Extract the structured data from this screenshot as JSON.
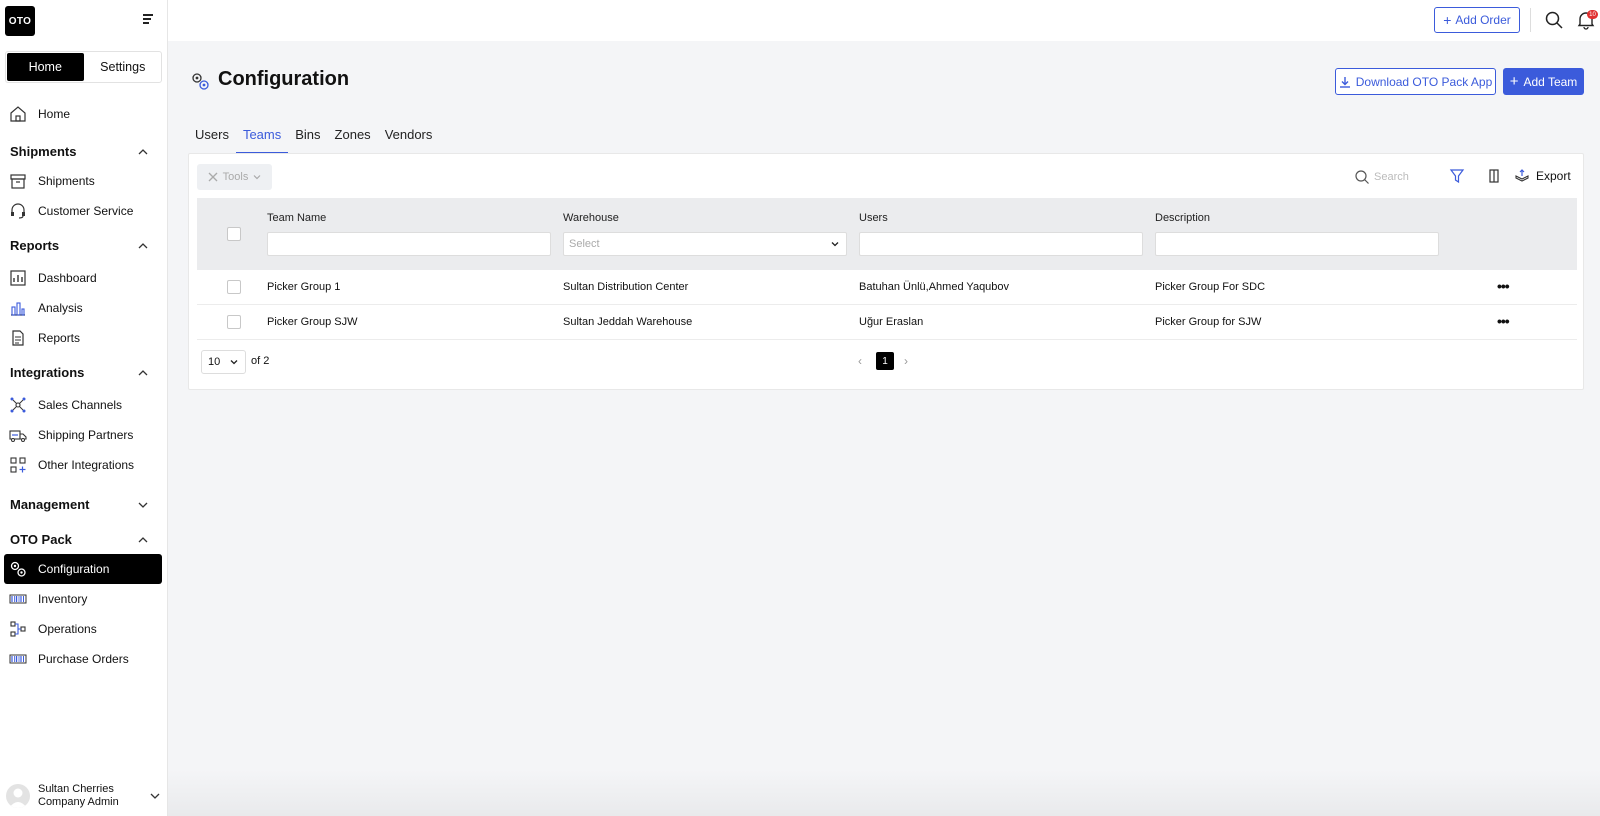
{
  "app": {
    "logo_text": "OTO"
  },
  "sidebar": {
    "modes": [
      "Home",
      "Settings"
    ],
    "home_label": "Home",
    "sections": {
      "shipments": {
        "title": "Shipments",
        "items": [
          "Shipments",
          "Customer Service"
        ]
      },
      "reports": {
        "title": "Reports",
        "items": [
          "Dashboard",
          "Analysis",
          "Reports"
        ]
      },
      "integrations": {
        "title": "Integrations",
        "items": [
          "Sales Channels",
          "Shipping Partners",
          "Other Integrations"
        ]
      },
      "management": {
        "title": "Management"
      },
      "oto_pack": {
        "title": "OTO Pack",
        "items": [
          "Configuration",
          "Inventory",
          "Operations",
          "Purchase Orders"
        ]
      }
    },
    "user": {
      "name": "Sultan Cherries",
      "role": "Company Admin"
    }
  },
  "topbar": {
    "add_order": "Add Order",
    "notification_count": "10"
  },
  "page": {
    "title": "Configuration",
    "download_button": "Download OTO Pack App",
    "add_team_button": "Add Team"
  },
  "tabs": [
    "Users",
    "Teams",
    "Bins",
    "Zones",
    "Vendors"
  ],
  "active_tab": "Teams",
  "toolbar": {
    "tools": "Tools",
    "search_placeholder": "Search",
    "export": "Export"
  },
  "table": {
    "columns": [
      "Team Name",
      "Warehouse",
      "Users",
      "Description"
    ],
    "warehouse_filter_placeholder": "Select",
    "rows": [
      {
        "team_name": "Picker Group 1",
        "warehouse": "Sultan Distribution Center",
        "users": "Batuhan Ünlü,Ahmed Yaqubov",
        "description": "Picker Group For SDC"
      },
      {
        "team_name": "Picker Group SJW",
        "warehouse": "Sultan Jeddah Warehouse",
        "users": "Uğur Eraslan",
        "description": "Picker Group for SJW"
      }
    ]
  },
  "pagination": {
    "page_size": "10",
    "of_text": "of 2",
    "current_page": "1"
  },
  "colors": {
    "accent": "#3b5bdb",
    "active_bg": "#000000",
    "badge": "#e03131"
  }
}
